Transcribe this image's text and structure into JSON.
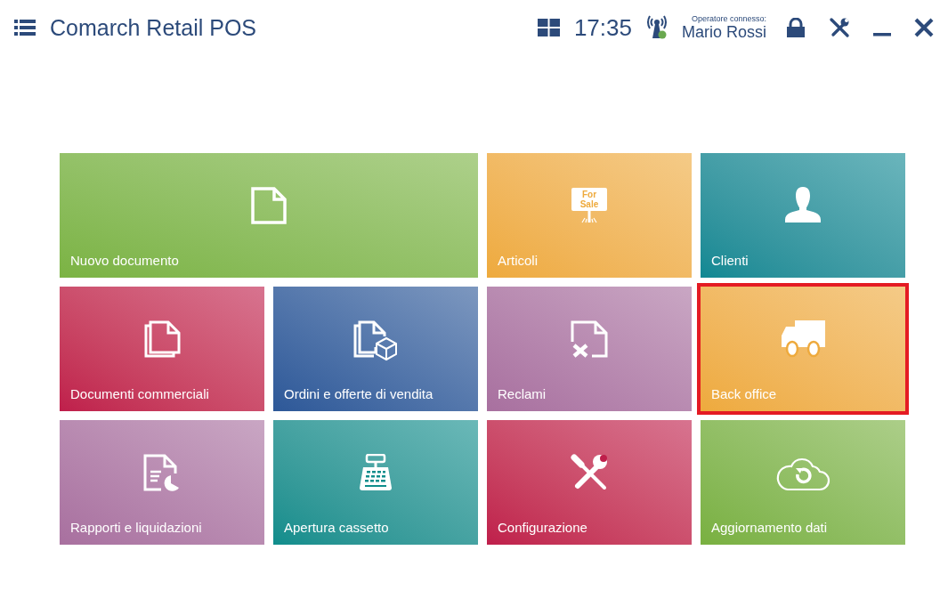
{
  "header": {
    "title": "Comarch Retail POS",
    "time": "17:35",
    "connected": true,
    "operator_label": "Operatore connesso:",
    "operator_name": "Mario Rossi"
  },
  "tiles": [
    {
      "label": "Nuovo documento",
      "kind": "document",
      "color": "#7bb343",
      "wide": true,
      "selected": false
    },
    {
      "label": "Articoli",
      "kind": "sale-sign",
      "color": "#eeaa3d",
      "wide": false,
      "selected": false,
      "sign_lines": [
        "For",
        "Sale"
      ]
    },
    {
      "label": "Clienti",
      "kind": "person",
      "color": "#0f8893",
      "wide": false,
      "selected": false
    },
    {
      "label": "Documenti commerciali",
      "kind": "documents",
      "color": "#bf1e4b",
      "wide": false,
      "selected": false
    },
    {
      "label": "Ordini e offerte di vendita",
      "kind": "documents-box",
      "color": "#2d5898",
      "wide": false,
      "selected": false
    },
    {
      "label": "Reclami",
      "kind": "document-x",
      "color": "#a8709f",
      "wide": false,
      "selected": false
    },
    {
      "label": "Back office",
      "kind": "truck",
      "color": "#eeaa3d",
      "wide": false,
      "selected": true
    },
    {
      "label": "Rapporti e liquidazioni",
      "kind": "report",
      "color": "#a8709f",
      "wide": false,
      "selected": false
    },
    {
      "label": "Apertura cassetto",
      "kind": "register",
      "color": "#0f8d8c",
      "wide": false,
      "selected": false
    },
    {
      "label": "Configurazione",
      "kind": "tools",
      "color": "#bf1e4b",
      "wide": false,
      "selected": false
    },
    {
      "label": "Aggiornamento dati",
      "kind": "cloud-sync",
      "color": "#79b040",
      "wide": false,
      "selected": false
    }
  ]
}
